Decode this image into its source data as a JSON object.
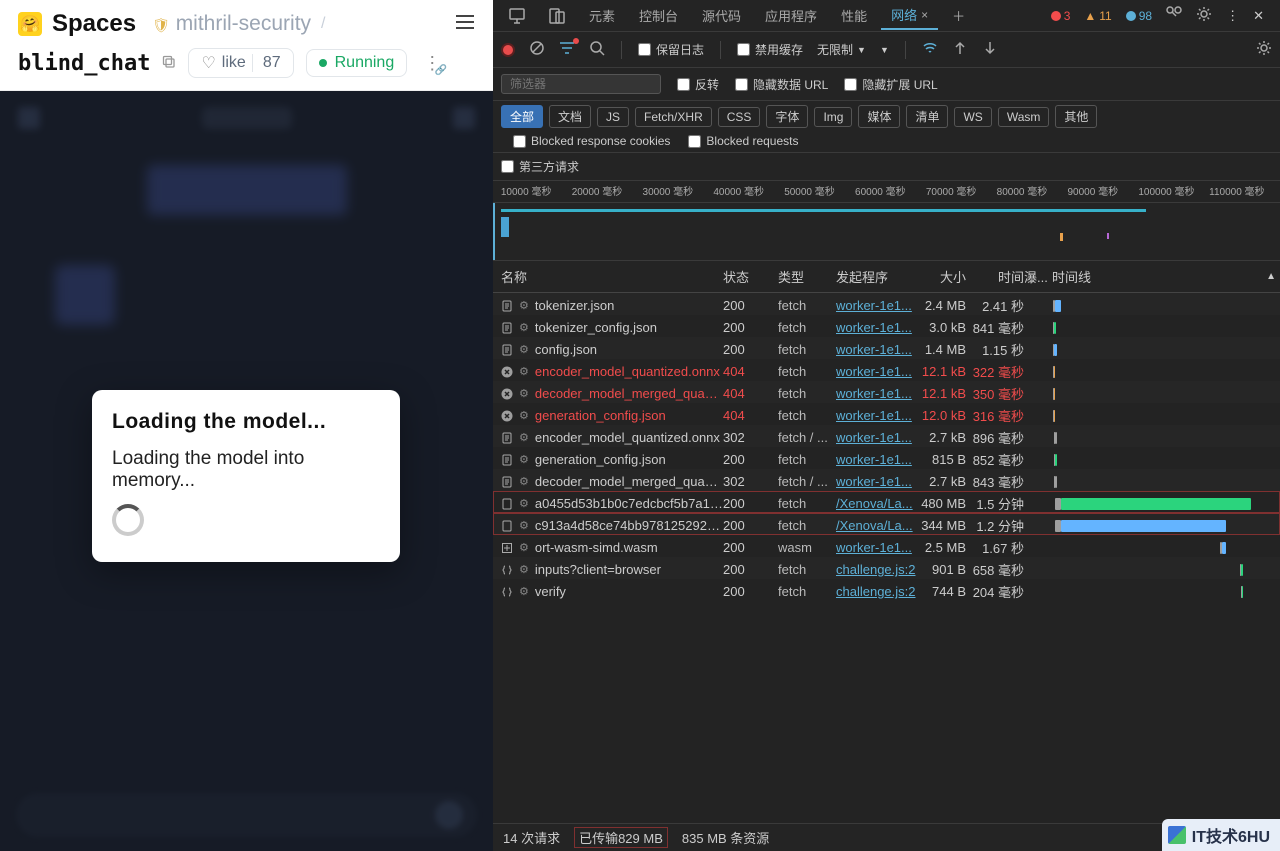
{
  "left": {
    "logo_emoji": "🤗",
    "spaces": "Spaces",
    "org_icon": "🛡",
    "org": "mithril-security",
    "slash": "/",
    "space_name": "blind_chat",
    "like_label": "like",
    "like_count": "87",
    "running": "Running",
    "modal_title": "Loading the model...",
    "modal_body": "Loading the model into memory..."
  },
  "tabs": {
    "items": [
      "元素",
      "控制台",
      "源代码",
      "应用程序",
      "性能",
      "网络"
    ],
    "active_index": 5,
    "errors": "3",
    "warnings": "11",
    "info": "98"
  },
  "toolbar": {
    "keep_log": "保留日志",
    "disable_cache": "禁用缓存",
    "throttle": "无限制"
  },
  "filters": {
    "placeholder": "筛选器",
    "invert": "反转",
    "hide_data_url": "隐藏数据 URL",
    "hide_ext_url": "隐藏扩展 URL",
    "chips": [
      "全部",
      "文档",
      "JS",
      "Fetch/XHR",
      "CSS",
      "字体",
      "Img",
      "媒体",
      "清单",
      "WS",
      "Wasm",
      "其他"
    ],
    "blocked_cookies": "Blocked response cookies",
    "blocked_requests": "Blocked requests",
    "third_party": "第三方请求"
  },
  "ruler": [
    "10000 毫秒",
    "20000 毫秒",
    "30000 毫秒",
    "40000 毫秒",
    "50000 毫秒",
    "60000 毫秒",
    "70000 毫秒",
    "80000 毫秒",
    "90000 毫秒",
    "100000 毫秒",
    "110000 毫秒"
  ],
  "columns": {
    "name": "名称",
    "status": "状态",
    "type": "类型",
    "initiator": "发起程序",
    "size": "大小",
    "time": "时间",
    "priority": "瀑...",
    "waterfall": "时间线"
  },
  "rows": [
    {
      "icon": "json",
      "name": "tokenizer.json",
      "status": "200",
      "type": "fetch",
      "init": "worker-1e1...",
      "size": "2.4 MB",
      "time": "2.41 秒",
      "err": false,
      "wf": [
        1,
        2,
        6,
        "#64b4ff"
      ]
    },
    {
      "icon": "json",
      "name": "tokenizer_config.json",
      "status": "200",
      "type": "fetch",
      "init": "worker-1e1...",
      "size": "3.0 kB",
      "time": "841 毫秒",
      "err": false,
      "wf": [
        1,
        1,
        2,
        "#2bd47d"
      ]
    },
    {
      "icon": "json",
      "name": "config.json",
      "status": "200",
      "type": "fetch",
      "init": "worker-1e1...",
      "size": "1.4 MB",
      "time": "1.15 秒",
      "err": false,
      "wf": [
        1,
        1,
        3,
        "#64b4ff"
      ]
    },
    {
      "icon": "x",
      "name": "encoder_model_quantized.onnx",
      "status": "404",
      "type": "fetch",
      "init": "worker-1e1...",
      "size": "12.1 kB",
      "time": "322 毫秒",
      "err": true,
      "wf": [
        1,
        1,
        1,
        "#e8a14c"
      ]
    },
    {
      "icon": "x",
      "name": "decoder_model_merged_quanti...",
      "status": "404",
      "type": "fetch",
      "init": "worker-1e1...",
      "size": "12.1 kB",
      "time": "350 毫秒",
      "err": true,
      "wf": [
        1,
        1,
        1,
        "#e8a14c"
      ]
    },
    {
      "icon": "x",
      "name": "generation_config.json",
      "status": "404",
      "type": "fetch",
      "init": "worker-1e1...",
      "size": "12.0 kB",
      "time": "316 毫秒",
      "err": true,
      "wf": [
        1,
        1,
        1,
        "#e8a14c"
      ]
    },
    {
      "icon": "json",
      "name": "encoder_model_quantized.onnx",
      "status": "302",
      "type": "fetch / ...",
      "init": "worker-1e1...",
      "size": "2.7 kB",
      "time": "896 毫秒",
      "err": false,
      "wf": [
        2,
        1,
        2,
        "#9e9e9e"
      ]
    },
    {
      "icon": "json",
      "name": "generation_config.json",
      "status": "200",
      "type": "fetch",
      "init": "worker-1e1...",
      "size": "815 B",
      "time": "852 毫秒",
      "err": false,
      "wf": [
        2,
        1,
        2,
        "#2bd47d"
      ]
    },
    {
      "icon": "json",
      "name": "decoder_model_merged_quanti...",
      "status": "302",
      "type": "fetch / ...",
      "init": "worker-1e1...",
      "size": "2.7 kB",
      "time": "843 毫秒",
      "err": false,
      "wf": [
        2,
        1,
        2,
        "#9e9e9e"
      ]
    },
    {
      "icon": "doc",
      "name": "a0455d53b1b0c7edcbcf5b7a17...",
      "status": "200",
      "type": "fetch",
      "init": "/Xenova/La...",
      "size": "480 MB",
      "time": "1.5 分钟",
      "err": false,
      "hl": true,
      "wf": [
        3,
        6,
        190,
        "#2bd47d"
      ]
    },
    {
      "icon": "doc",
      "name": "c913a4d58ce74bb97812529266...",
      "status": "200",
      "type": "fetch",
      "init": "/Xenova/La...",
      "size": "344 MB",
      "time": "1.2 分钟",
      "err": false,
      "hl": true,
      "wf": [
        3,
        6,
        165,
        "#64b4ff"
      ]
    },
    {
      "icon": "wasm",
      "name": "ort-wasm-simd.wasm",
      "status": "200",
      "type": "wasm",
      "init": "worker-1e1...",
      "size": "2.5 MB",
      "time": "1.67 秒",
      "err": false,
      "wf": [
        168,
        2,
        4,
        "#64b4ff"
      ]
    },
    {
      "icon": "js",
      "name": "inputs?client=browser",
      "status": "200",
      "type": "fetch",
      "init": "challenge.js:2",
      "size": "901 B",
      "time": "658 毫秒",
      "err": false,
      "wf": [
        188,
        1,
        2,
        "#2bd47d"
      ]
    },
    {
      "icon": "js",
      "name": "verify",
      "status": "200",
      "type": "fetch",
      "init": "challenge.js:2",
      "size": "744 B",
      "time": "204 毫秒",
      "err": false,
      "wf": [
        189,
        1,
        1,
        "#2bd47d"
      ]
    }
  ],
  "status": {
    "req": "14 次请求",
    "transfer": "已传输829 MB",
    "resources": "835 MB 条资源"
  },
  "watermark": "IT技术6HU"
}
